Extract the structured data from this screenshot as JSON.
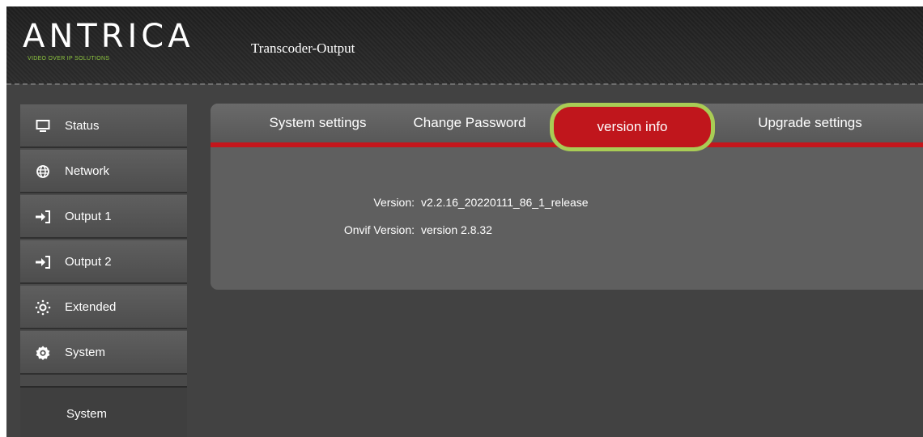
{
  "header": {
    "brand": "ANTRICA",
    "tagline": "VIDEO OVER IP SOLUTIONS",
    "product_title": "Transcoder-Output"
  },
  "sidebar": {
    "items": [
      {
        "label": "Status",
        "icon": "monitor-icon"
      },
      {
        "label": "Network",
        "icon": "globe-icon"
      },
      {
        "label": "Output 1",
        "icon": "enter-arrow-icon"
      },
      {
        "label": "Output 2",
        "icon": "enter-arrow-icon"
      },
      {
        "label": "Extended",
        "icon": "extended-gear-icon"
      },
      {
        "label": "System",
        "icon": "system-gear-icon"
      }
    ],
    "sub_item": {
      "label": "System"
    }
  },
  "tabs": [
    {
      "label": "System settings"
    },
    {
      "label": "Change Password"
    },
    {
      "label": "version info",
      "active": true
    },
    {
      "label": "Upgrade settings"
    }
  ],
  "version_info": {
    "version_label": "Version:",
    "version_value": "v2.2.16_20220111_86_1_release",
    "onvif_label": "Onvif Version:",
    "onvif_value": "version 2.8.32"
  },
  "colors": {
    "accent_red": "#c4161c",
    "highlight_green": "#a9cc55",
    "brand_green": "#8dc63f"
  }
}
